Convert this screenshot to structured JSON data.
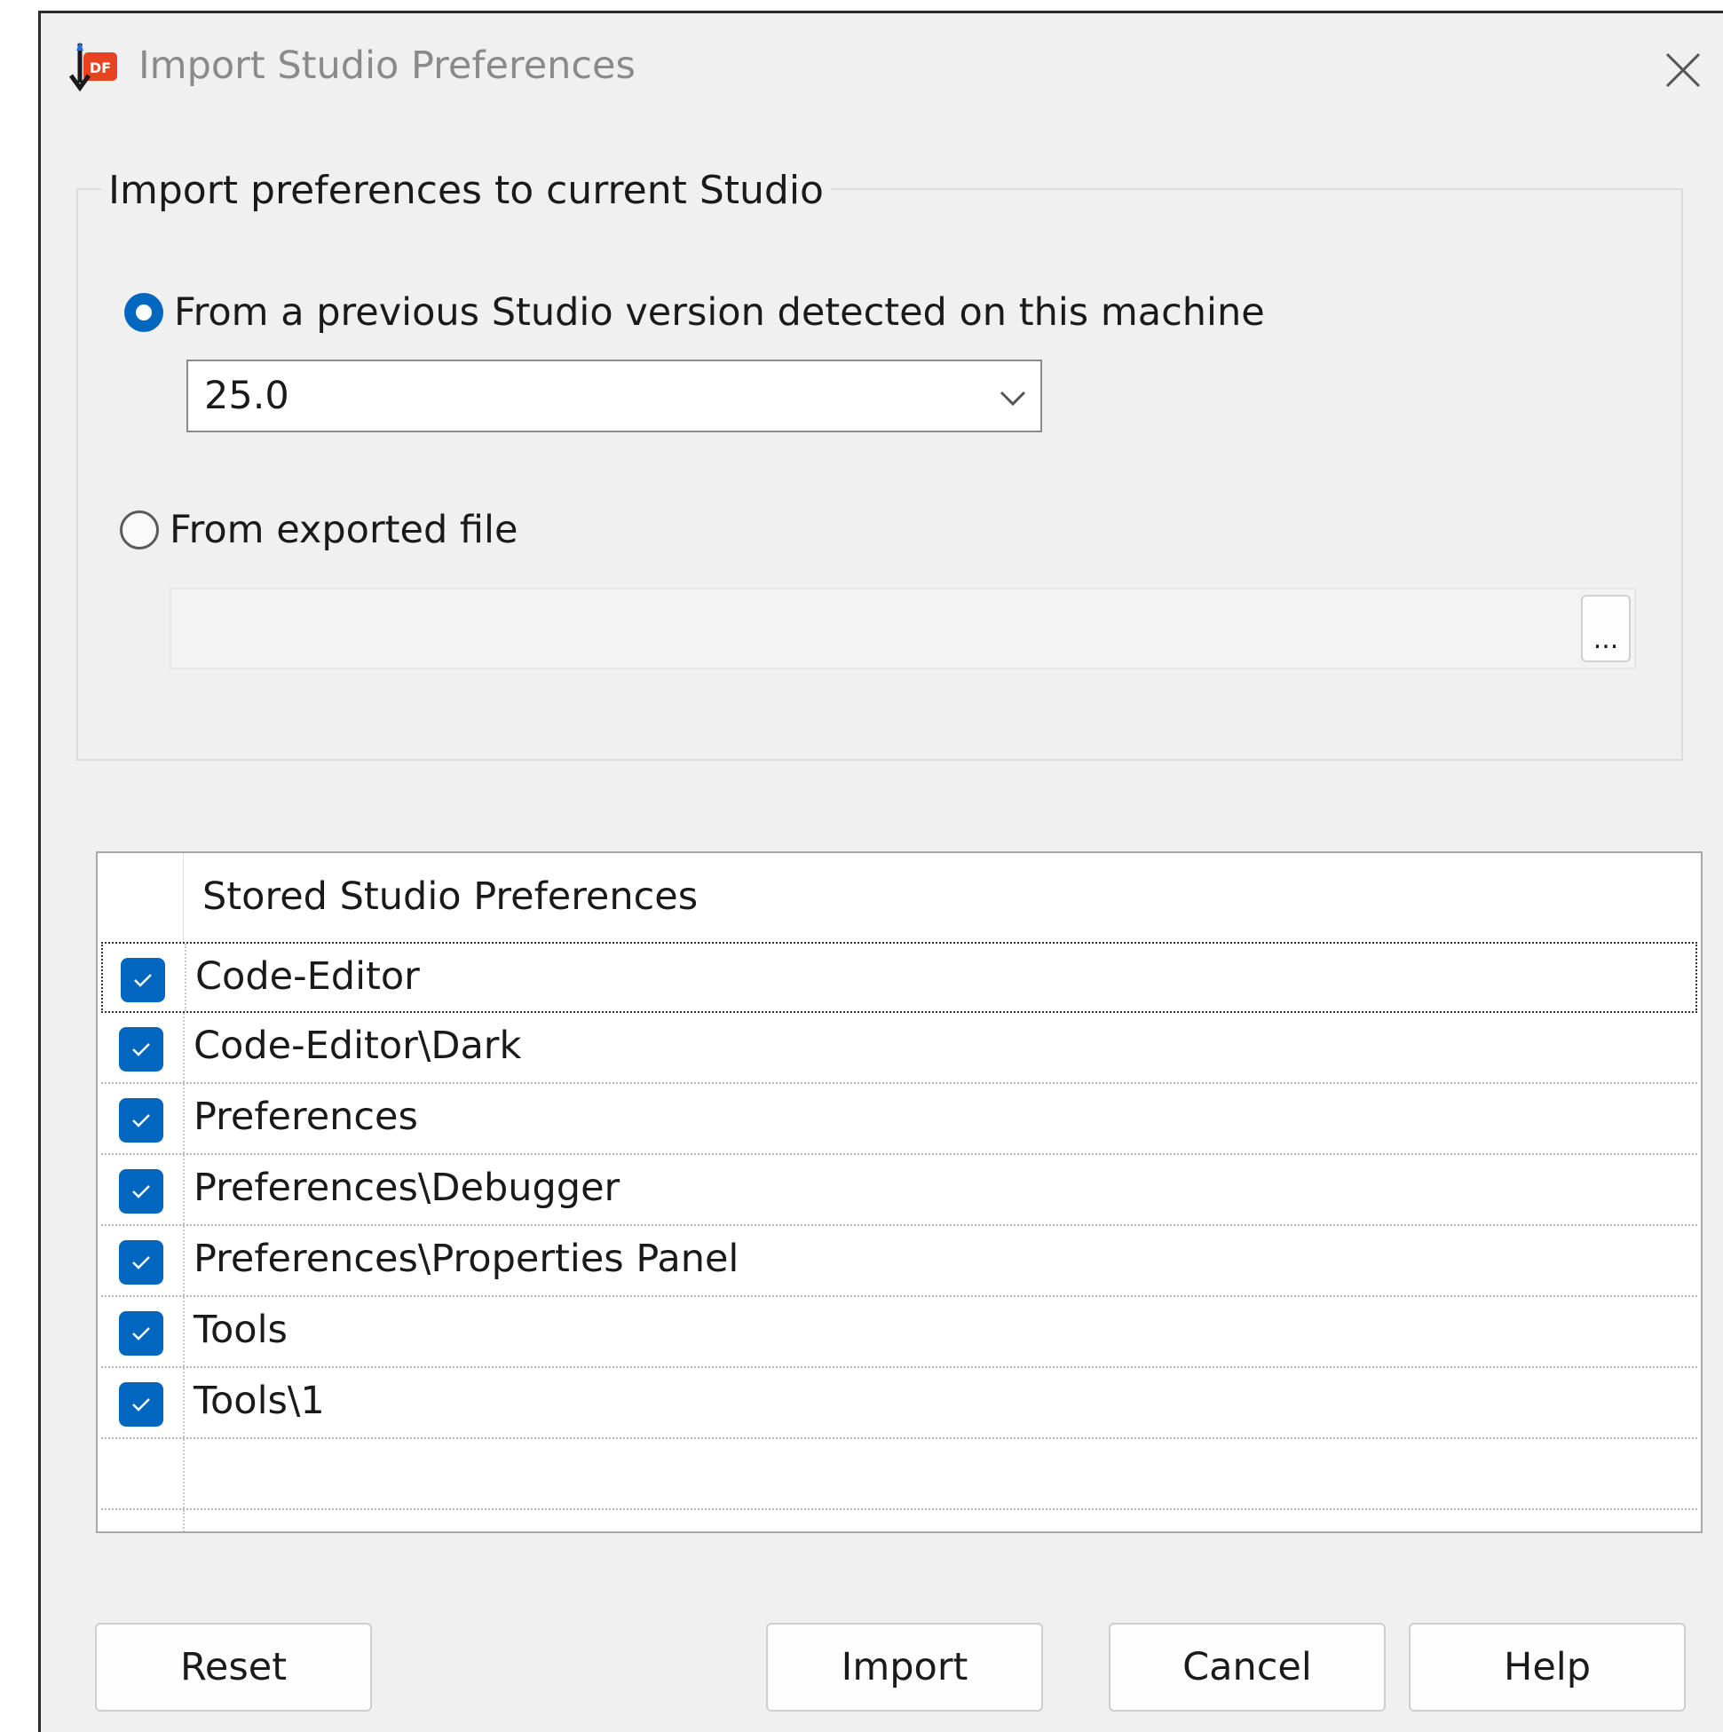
{
  "window": {
    "title": "Import Studio Preferences",
    "app_icon": "studio-import-icon",
    "close_icon": "close-icon"
  },
  "group": {
    "legend": "Import preferences to current Studio",
    "option_previous": "From a previous Studio version detected on this machine",
    "option_file": "From exported file",
    "selected_option": "previous",
    "version_select": {
      "value": "25.0"
    },
    "file_path": {
      "value": ""
    },
    "browse_label": "..."
  },
  "list": {
    "column_header": "Stored Studio Preferences",
    "items": [
      {
        "label": "Code-Editor",
        "checked": true
      },
      {
        "label": "Code-Editor\\Dark",
        "checked": true
      },
      {
        "label": "Preferences",
        "checked": true
      },
      {
        "label": "Preferences\\Debugger",
        "checked": true
      },
      {
        "label": "Preferences\\Properties Panel",
        "checked": true
      },
      {
        "label": "Tools",
        "checked": true
      },
      {
        "label": "Tools\\1",
        "checked": true
      }
    ]
  },
  "buttons": {
    "reset": "Reset",
    "import": "Import",
    "cancel": "Cancel",
    "help": "Help"
  },
  "colors": {
    "accent": "#0067c0",
    "window_bg": "#f0f0f0",
    "title_text": "#8a8a8a"
  }
}
